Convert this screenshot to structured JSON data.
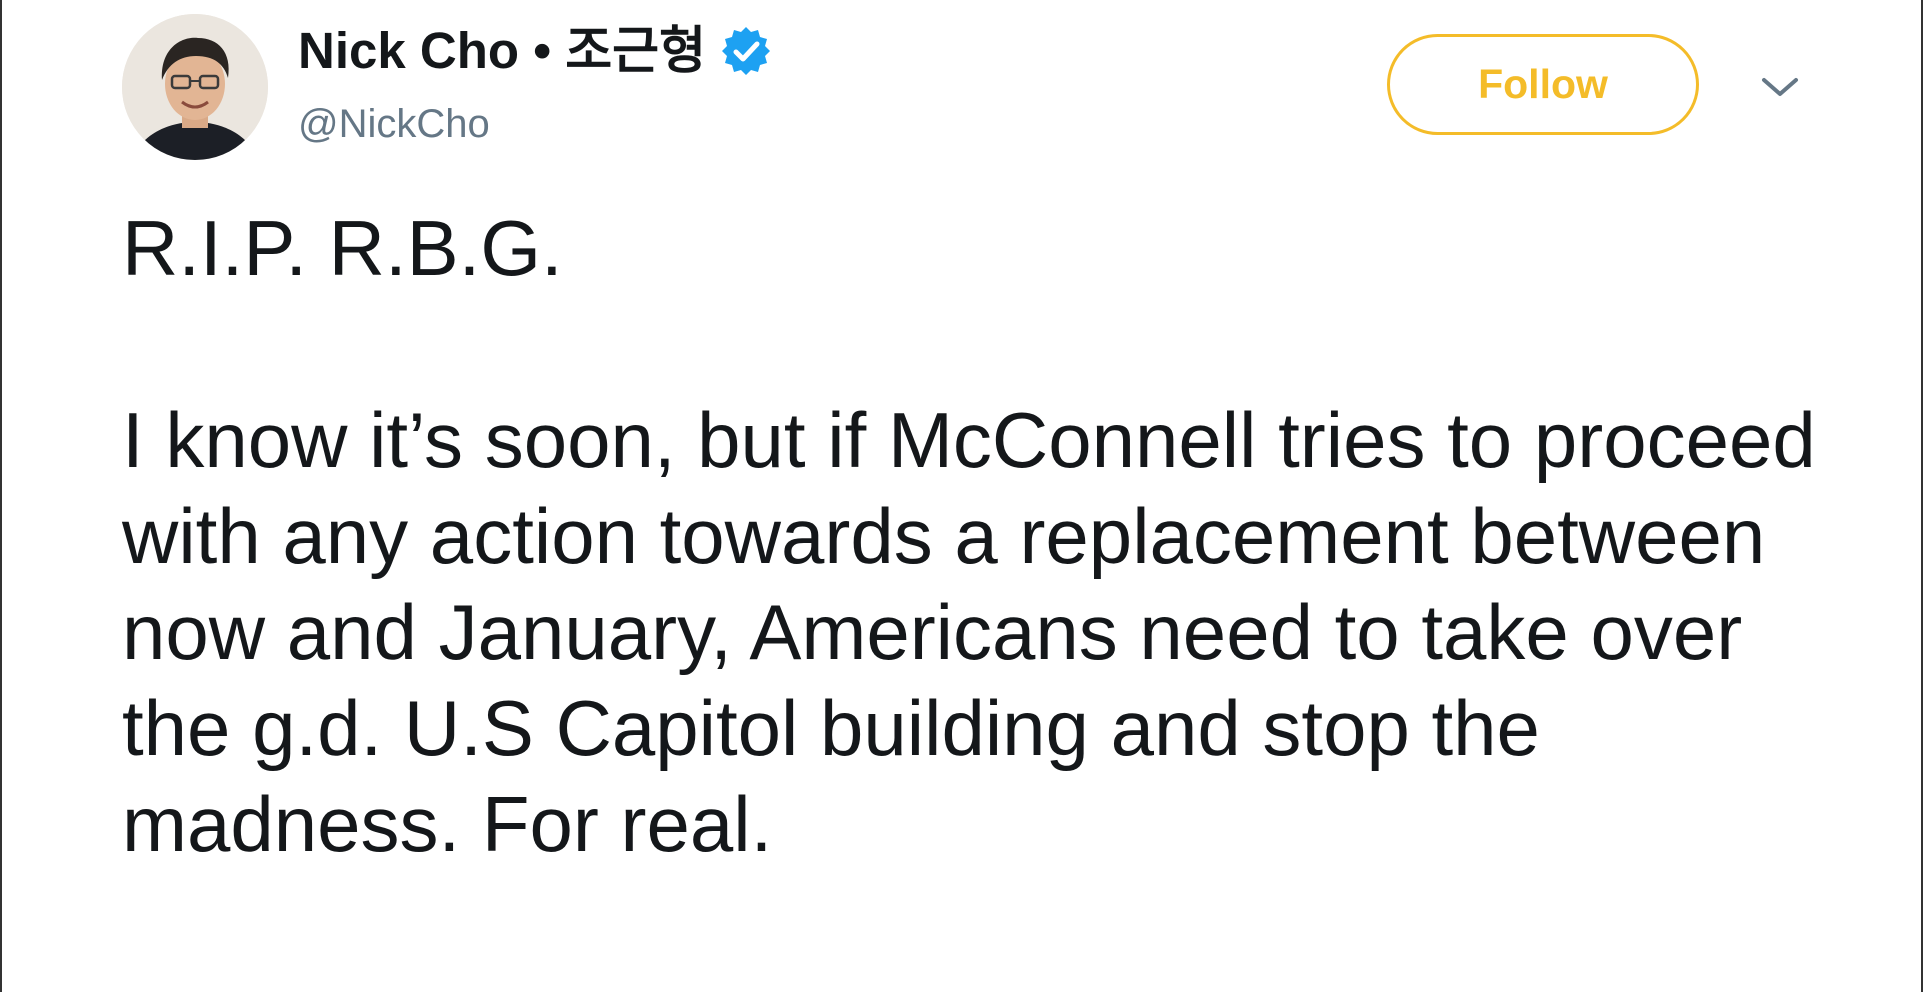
{
  "user": {
    "display_name": "Nick Cho • 조근형",
    "handle": "@NickCho",
    "verified_icon": "verified-badge-icon",
    "avatar_icon": "user-avatar"
  },
  "actions": {
    "follow_label": "Follow",
    "menu_icon": "chevron-down-icon"
  },
  "tweet": {
    "line1": "R.I.P. R.B.G.",
    "body": "I know it’s soon, but if McConnell tries to proceed with any action towards a replacement between now and January, Americans need to take over the g.d. U.S Capitol building and stop the madness. For real."
  },
  "colors": {
    "follow_accent": "#f4bc29",
    "verified_blue": "#1da1f2",
    "text": "#14171a",
    "handle_gray": "#657786"
  }
}
